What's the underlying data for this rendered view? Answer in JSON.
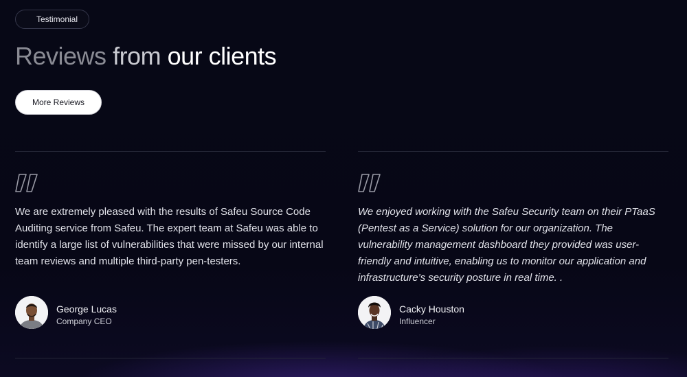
{
  "badge": {
    "label": "Testimonial"
  },
  "heading": {
    "word1": "Reviews",
    "word2": "from",
    "word3": "our clients"
  },
  "more_button": {
    "label": "More Reviews"
  },
  "reviews": [
    {
      "text": "We are extremely pleased with the results of Safeu Source Code Auditing service from Safeu. The expert team at Safeu was able to identify a large list of vulnerabilities that were missed by our internal team reviews and multiple third-party pen-testers.",
      "name": "George Lucas",
      "role": "Company CEO",
      "icon": "quote-icon"
    },
    {
      "text": "We enjoyed working with the Safeu Security team on their PTaaS (Pentest as a Service) solution for our organization. The vulnerability management dashboard they provided was user-friendly and intuitive, enabling us to monitor our application and infrastructure’s security posture in real time. .",
      "name": "Cacky Houston",
      "role": "Influencer",
      "icon": "quote-icon"
    }
  ],
  "colors": {
    "background": "#060713",
    "accent_glow": "#46289a",
    "divider": "#262838",
    "quote_icon": "#9a9ba6"
  }
}
